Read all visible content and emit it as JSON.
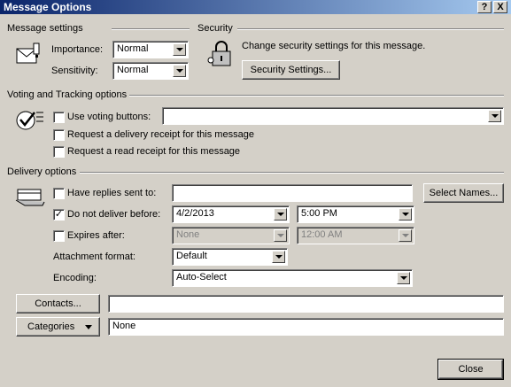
{
  "window": {
    "title": "Message Options",
    "help_glyph": "?",
    "close_glyph": "X"
  },
  "message_settings": {
    "header": "Message settings",
    "importance_label": "Importance:",
    "importance_value": "Normal",
    "sensitivity_label": "Sensitivity:",
    "sensitivity_value": "Normal"
  },
  "security": {
    "header": "Security",
    "description": "Change security settings for this message.",
    "button_label": "Security Settings..."
  },
  "voting": {
    "header": "Voting and Tracking options",
    "use_voting_label": "Use voting buttons:",
    "use_voting_checked": false,
    "use_voting_value": "",
    "delivery_receipt_label": "Request a delivery receipt for this message",
    "delivery_receipt_checked": false,
    "read_receipt_label": "Request a read receipt for this message",
    "read_receipt_checked": false
  },
  "delivery": {
    "header": "Delivery options",
    "replies_label": "Have replies sent to:",
    "replies_checked": false,
    "replies_value": "",
    "select_names_label": "Select Names...",
    "do_not_deliver_label": "Do not deliver before:",
    "do_not_deliver_checked": true,
    "do_not_deliver_date": "4/2/2013",
    "do_not_deliver_time": "5:00 PM",
    "expires_label": "Expires after:",
    "expires_checked": false,
    "expires_date": "None",
    "expires_time": "12:00 AM",
    "attachment_format_label": "Attachment format:",
    "attachment_format_value": "Default",
    "encoding_label": "Encoding:",
    "encoding_value": "Auto-Select"
  },
  "contacts": {
    "button_label": "Contacts...",
    "value": ""
  },
  "categories": {
    "button_label": "Categories",
    "value": "None"
  },
  "footer": {
    "close_label": "Close"
  },
  "icons": [
    "message-settings-icon",
    "security-lock-icon",
    "voting-icon",
    "delivery-icon"
  ]
}
